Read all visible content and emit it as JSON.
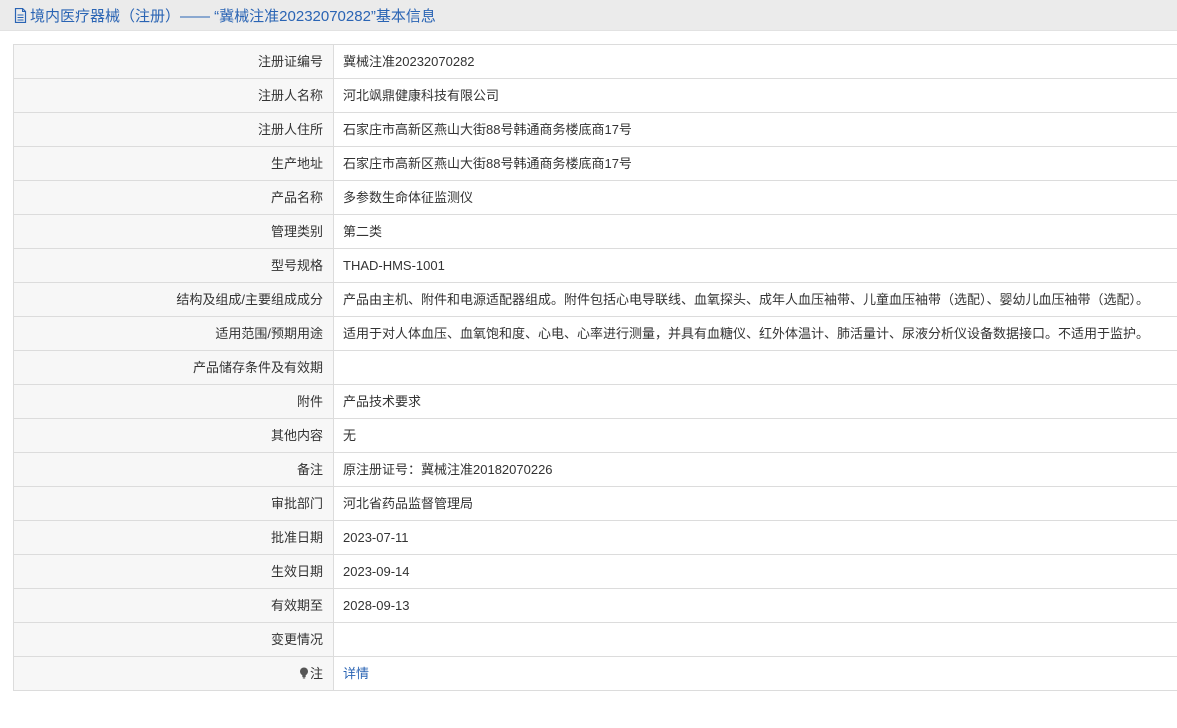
{
  "title": "境内医疗器械（注册）——  “冀械注准20232070282”基本信息",
  "rows": [
    {
      "label": "注册证编号",
      "value": "冀械注准20232070282"
    },
    {
      "label": "注册人名称",
      "value": "河北飒鼎健康科技有限公司"
    },
    {
      "label": "注册人住所",
      "value": "石家庄市高新区燕山大街88号韩通商务楼底商17号"
    },
    {
      "label": "生产地址",
      "value": "石家庄市高新区燕山大街88号韩通商务楼底商17号"
    },
    {
      "label": "产品名称",
      "value": "多参数生命体征监测仪"
    },
    {
      "label": "管理类别",
      "value": "第二类"
    },
    {
      "label": "型号规格",
      "value": "THAD-HMS-1001"
    },
    {
      "label": "结构及组成/主要组成成分",
      "value": "产品由主机、附件和电源适配器组成。附件包括心电导联线、血氧探头、成年人血压袖带、儿童血压袖带（选配）、婴幼儿血压袖带（选配）。"
    },
    {
      "label": "适用范围/预期用途",
      "value": "适用于对人体血压、血氧饱和度、心电、心率进行测量，并具有血糖仪、红外体温计、肺活量计、尿液分析仪设备数据接口。不适用于监护。"
    },
    {
      "label": "产品储存条件及有效期",
      "value": ""
    },
    {
      "label": "附件",
      "value": "产品技术要求"
    },
    {
      "label": "其他内容",
      "value": "无"
    },
    {
      "label": "备注",
      "value": "原注册证号：冀械注准20182070226"
    },
    {
      "label": "审批部门",
      "value": "河北省药品监督管理局"
    },
    {
      "label": "批准日期",
      "value": "2023-07-11"
    },
    {
      "label": "生效日期",
      "value": "2023-09-14"
    },
    {
      "label": "有效期至",
      "value": "2028-09-13"
    },
    {
      "label": "变更情况",
      "value": ""
    }
  ],
  "note": {
    "label": "注",
    "icon": "lightbulb-icon",
    "link_text": "详情"
  },
  "colors": {
    "link": "#2a64b4",
    "header_bg": "#ebebeb",
    "label_bg": "#f7f7f7",
    "border": "#dcdcdc"
  }
}
